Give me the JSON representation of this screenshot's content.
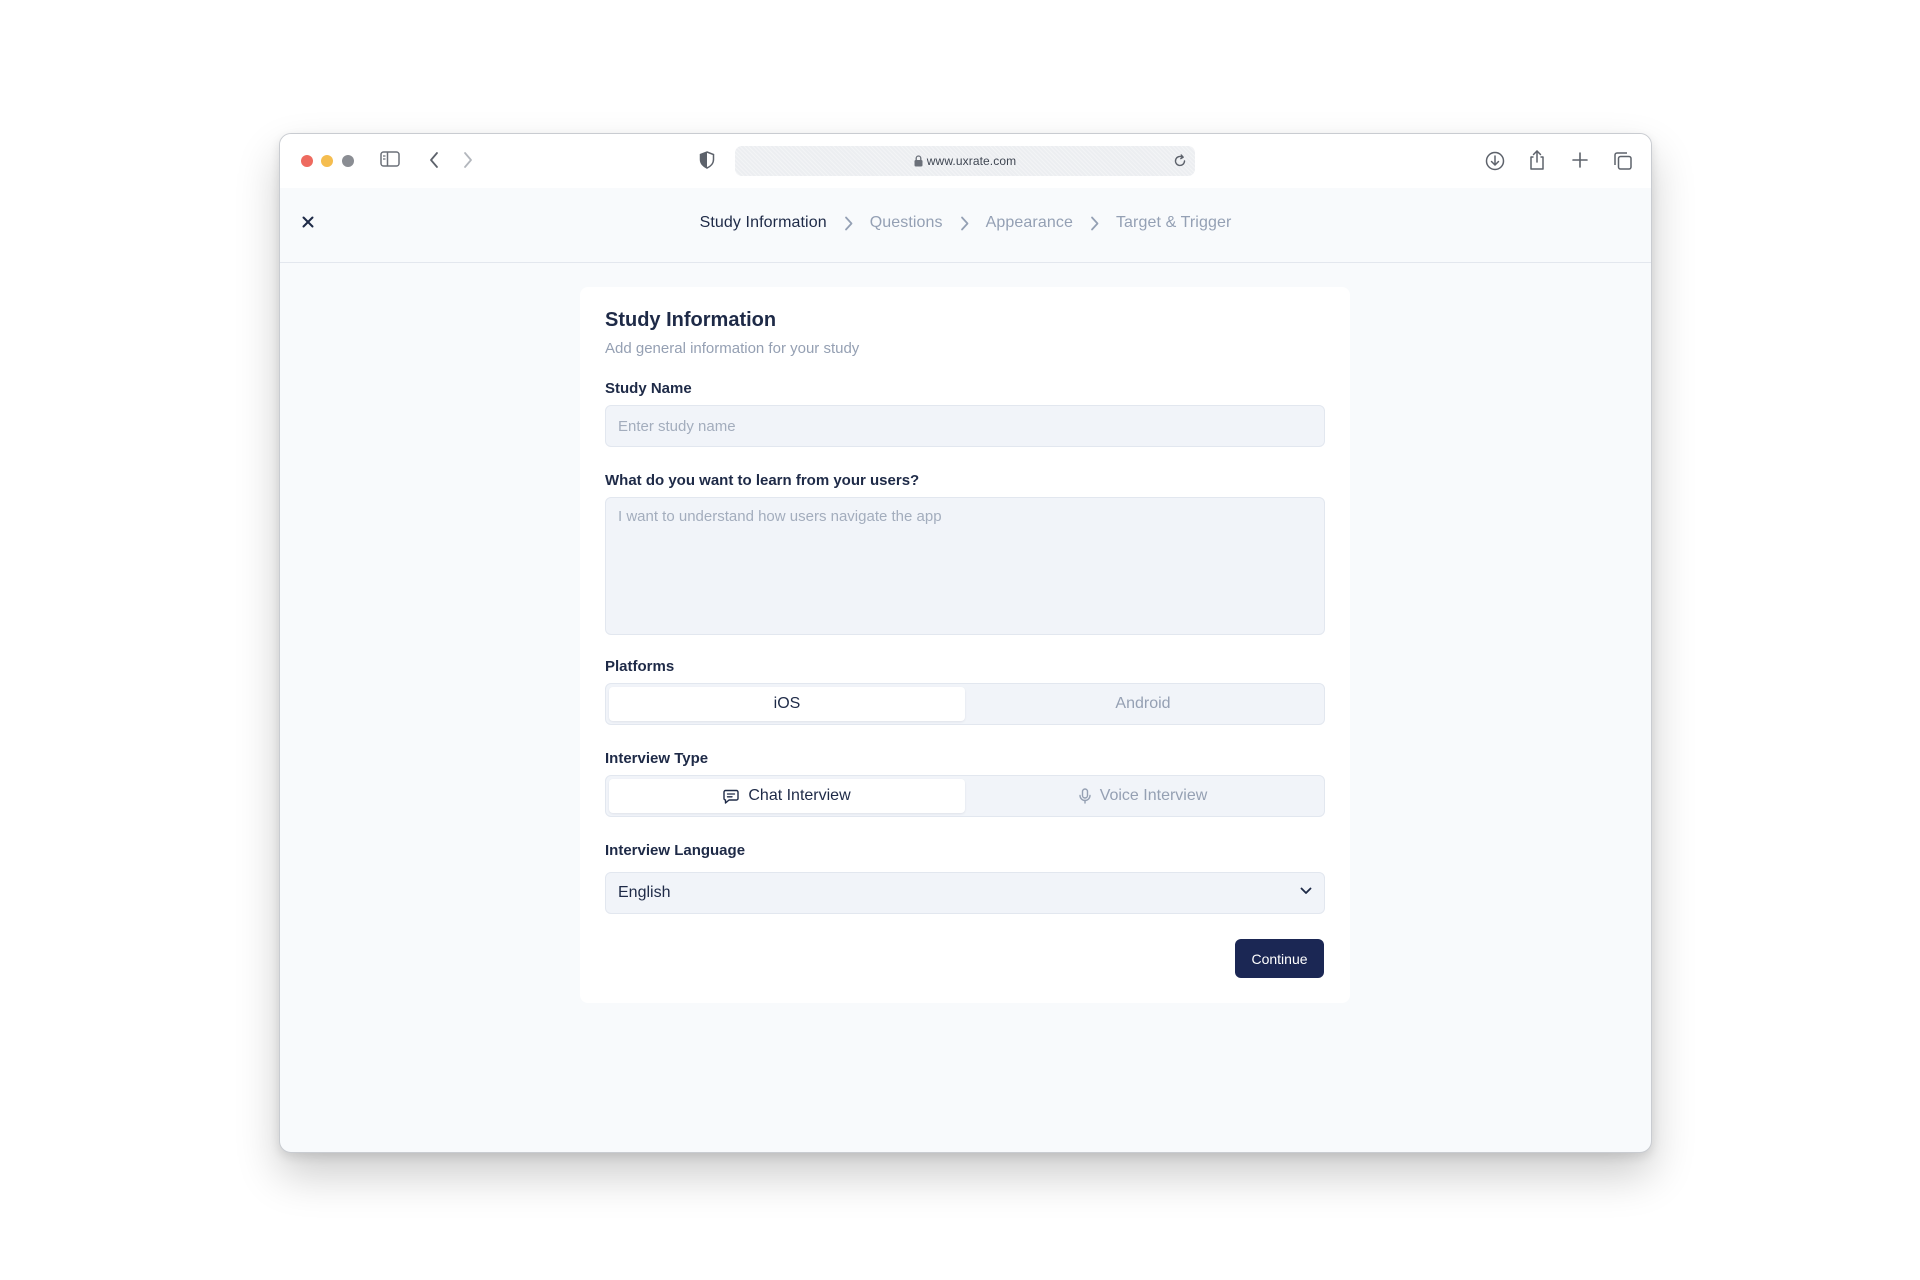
{
  "browser": {
    "url": "www.uxrate.com"
  },
  "stepper": {
    "steps": [
      {
        "label": "Study Information",
        "active": true
      },
      {
        "label": "Questions",
        "active": false
      },
      {
        "label": "Appearance",
        "active": false
      },
      {
        "label": "Target & Trigger",
        "active": false
      }
    ]
  },
  "form": {
    "title": "Study Information",
    "subtitle": "Add general information for your study",
    "study_name": {
      "label": "Study Name",
      "placeholder": "Enter study name",
      "value": ""
    },
    "learn_goal": {
      "label": "What do you want to learn from your users?",
      "placeholder": "I want to understand how users navigate the app",
      "value": ""
    },
    "platforms": {
      "label": "Platforms",
      "options": [
        "iOS",
        "Android"
      ],
      "selected": "iOS"
    },
    "interview_type": {
      "label": "Interview Type",
      "options": [
        {
          "label": "Chat Interview",
          "icon": "chat-icon"
        },
        {
          "label": "Voice Interview",
          "icon": "microphone-icon"
        }
      ],
      "selected": "Chat Interview"
    },
    "interview_language": {
      "label": "Interview Language",
      "value": "English"
    },
    "continue_label": "Continue"
  },
  "colors": {
    "primary": "#1b2754",
    "text": "#1e2a47",
    "muted": "#95a0b3",
    "field_bg": "#f1f4f9",
    "page_bg": "#f8fafc"
  }
}
